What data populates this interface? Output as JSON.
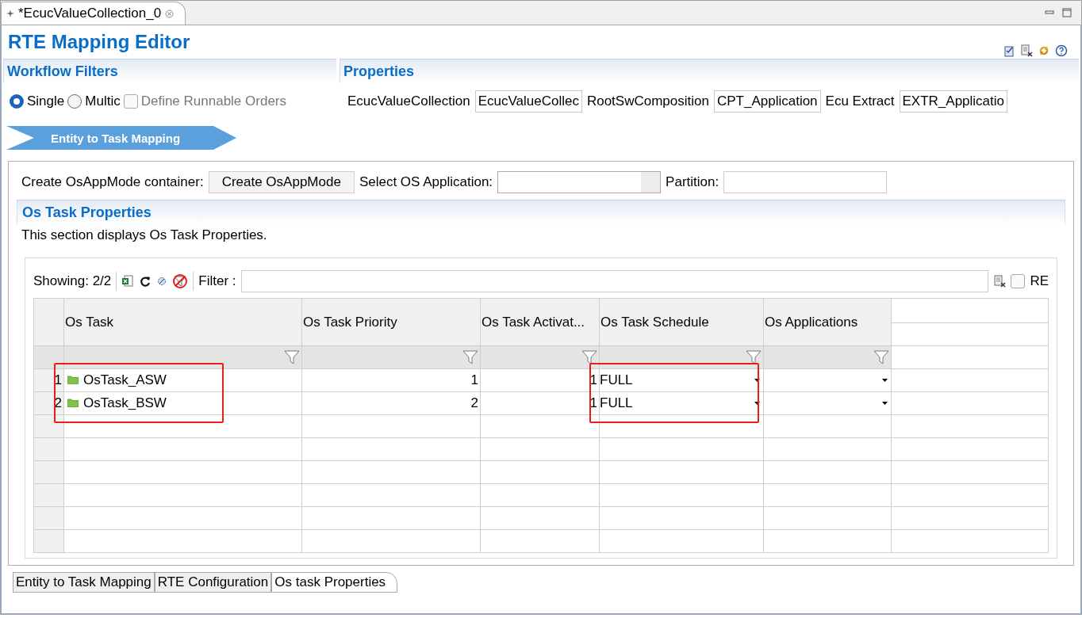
{
  "editor_tab": {
    "title": "*EcucValueCollection_0",
    "selected": true
  },
  "editor": {
    "title": "RTE Mapping Editor"
  },
  "workflow_filters": {
    "title": "Workflow Filters",
    "options": [
      {
        "kind": "radio",
        "label": "Single",
        "selected": true
      },
      {
        "kind": "radio",
        "label": "Multic",
        "selected": false
      },
      {
        "kind": "checkbox",
        "label": "Define Runnable Orders",
        "checked": false,
        "disabled": true
      }
    ]
  },
  "properties": {
    "title": "Properties",
    "fields": [
      {
        "label": "EcucValueCollection",
        "value": "EcucValueCollec"
      },
      {
        "label": "RootSwComposition",
        "value": "CPT_Application"
      },
      {
        "label": "Ecu Extract",
        "value": "EXTR_Applicatio"
      }
    ]
  },
  "breadcrumb": {
    "label": "Entity to Task Mapping"
  },
  "mapping": {
    "create_label": "Create OsAppMode container:",
    "create_button": "Create OsAppMode",
    "select_label": "Select OS Application:",
    "partition_label": "Partition:"
  },
  "section": {
    "title": "Os Task Properties",
    "description": "This section displays Os Task Properties."
  },
  "table_toolbar": {
    "showing": "Showing: 2/2",
    "filter_label": "Filter :",
    "regex_label": "RE",
    "regex_checked": false
  },
  "table": {
    "columns": [
      {
        "kind": "task",
        "label": "Os Task",
        "highlighted": true
      },
      {
        "kind": "number",
        "label": "Os Task Priority",
        "highlighted": false
      },
      {
        "kind": "number",
        "label": "Os Task Activat...",
        "highlighted": false
      },
      {
        "kind": "dropdown",
        "label": "Os Task Schedule",
        "highlighted": true
      },
      {
        "kind": "dropdown",
        "label": "Os Applications",
        "highlighted": false
      }
    ],
    "rows": [
      {
        "number": "1",
        "cells": [
          "OsTask_ASW",
          "1",
          "1",
          "FULL",
          null
        ]
      },
      {
        "number": "2",
        "cells": [
          "OsTask_BSW",
          "2",
          "1",
          "FULL",
          null
        ]
      }
    ]
  },
  "bottom_tabs": [
    {
      "label": "Entity to Task Mapping",
      "selected": false
    },
    {
      "label": "RTE Configuration",
      "selected": false
    },
    {
      "label": "Os task Properties",
      "selected": true
    }
  ]
}
